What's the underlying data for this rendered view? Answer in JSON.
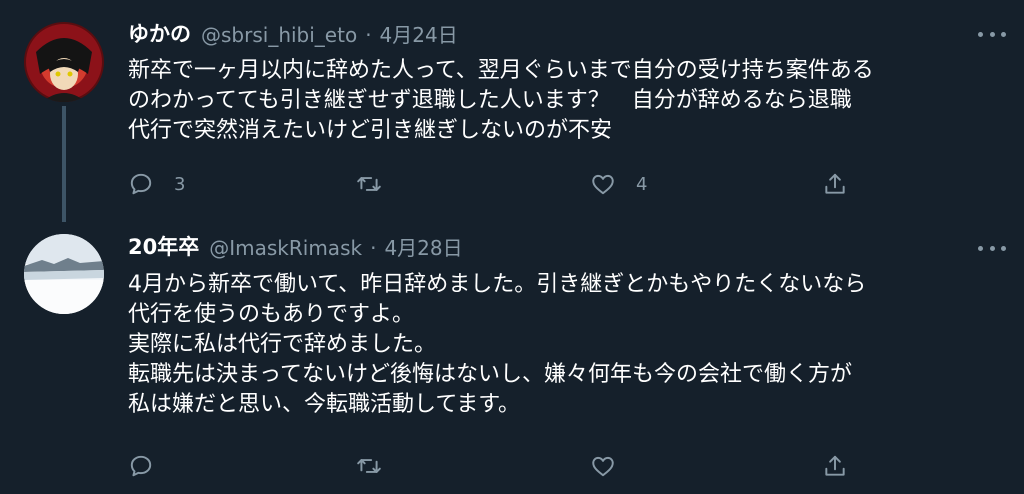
{
  "tweets": [
    {
      "name": "ゆかの",
      "handle": "@sbrsi_hibi_eto",
      "separator": "·",
      "date": "4月24日",
      "lines": [
        "新卒で一ヶ月以内に辞めた人って、翌月ぐらいまで自分の受け持ち案件ある",
        "のわかってても引き継ぎせず退職した人います？　自分が辞めるなら退職",
        "代行で突然消えたいけど引き継ぎしないのが不安"
      ],
      "reply_count": "3",
      "retweet_count": "",
      "like_count": "4"
    },
    {
      "name": "20年卒",
      "handle": "@ImaskRimask",
      "separator": "·",
      "date": "4月28日",
      "lines": [
        "4月から新卒で働いて、昨日辞めました。引き継ぎとかもやりたくないなら",
        "代行を使うのもありですよ。",
        "実際に私は代行で辞めました。",
        "転職先は決まってないけど後悔はないし、嫌々何年も今の会社で働く方が",
        "私は嫌だと思い、今転職活動してます。"
      ],
      "reply_count": "",
      "retweet_count": "",
      "like_count": ""
    }
  ],
  "icons": {
    "reply": "reply-icon",
    "retweet": "retweet-icon",
    "like": "like-icon",
    "share": "share-icon",
    "more": "more-icon"
  },
  "colors": {
    "background": "#15202b",
    "text": "#ffffff",
    "secondary": "#8899a6",
    "thread_line": "#3d5466"
  }
}
